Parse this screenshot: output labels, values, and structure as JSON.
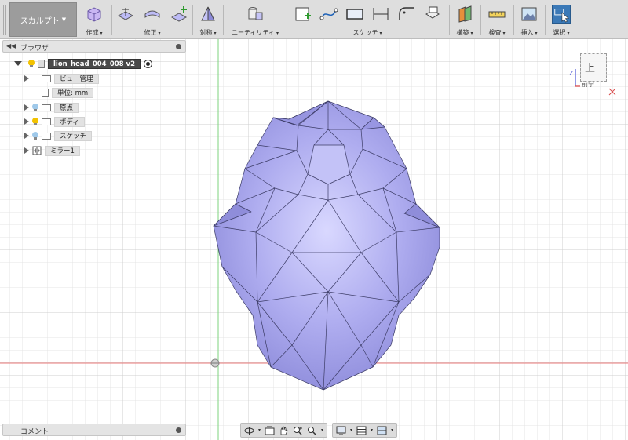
{
  "toolbar": {
    "workspace": "スカルプト",
    "groups": {
      "create": "作成",
      "modify": "修正",
      "symmetry": "対称",
      "utility": "ユーティリティ",
      "sketch": "スケッチ",
      "construct": "構築",
      "inspect": "検査",
      "insert": "挿入",
      "select": "選択"
    }
  },
  "browser": {
    "title": "ブラウザ",
    "root": "lion_head_004_008 v2",
    "items": [
      {
        "label": "ビュー管理"
      },
      {
        "label": "単位: mm"
      },
      {
        "label": "原点"
      },
      {
        "label": "ボディ"
      },
      {
        "label": "スケッチ"
      },
      {
        "label": "ミラー1"
      }
    ]
  },
  "comments": {
    "title": "コメント"
  },
  "viewcube": {
    "top": "上",
    "front": "前宁"
  },
  "colors": {
    "mesh_fill": "#a8a6ef",
    "mesh_edge": "#3c3c66",
    "grid_minor": "#e2e2e2",
    "grid_major": "#cfcfcf",
    "axis_x": "#e87878",
    "axis_y": "#7ed37e",
    "select_accent": "#3b79b7"
  }
}
